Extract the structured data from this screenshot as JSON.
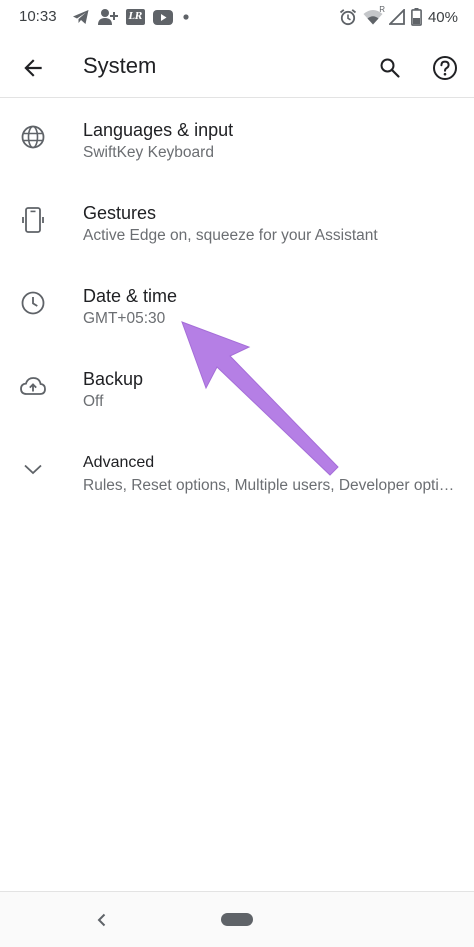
{
  "status_bar": {
    "time": "10:33",
    "left_icons": [
      "telegram-icon",
      "add-person-icon",
      "lr-app-icon",
      "youtube-icon",
      "notification-dot-icon"
    ],
    "right_icons": [
      "alarm-icon",
      "wifi-icon",
      "signal-icon",
      "battery-icon"
    ],
    "lr_label": "LR",
    "wifi_r_label": "R",
    "battery": "40%"
  },
  "toolbar": {
    "title": "System",
    "back_icon": "arrow-back-icon",
    "search_icon": "search-icon",
    "help_icon": "help-icon"
  },
  "settings": [
    {
      "title": "Languages & input",
      "summary": "SwiftKey Keyboard",
      "icon": "globe-icon"
    },
    {
      "title": "Gestures",
      "summary": "Active Edge on, squeeze for your Assistant",
      "icon": "gestures-icon"
    },
    {
      "title": "Date & time",
      "summary": "GMT+05:30",
      "icon": "clock-icon"
    },
    {
      "title": "Backup",
      "summary": "Off",
      "icon": "cloud-upload-icon"
    },
    {
      "title": "Advanced",
      "summary": "Rules, Reset options, Multiple users, Developer opti…",
      "icon": "chevron-down-icon"
    }
  ],
  "annotation": {
    "color": "#b57fe5",
    "target": "Date & time"
  },
  "nav_bar": {
    "back_icon": "nav-back-icon",
    "home_icon": "home-pill-icon"
  },
  "colors": {
    "text_primary": "#202124",
    "text_secondary": "#6b6e72",
    "icon": "#5f6368"
  }
}
